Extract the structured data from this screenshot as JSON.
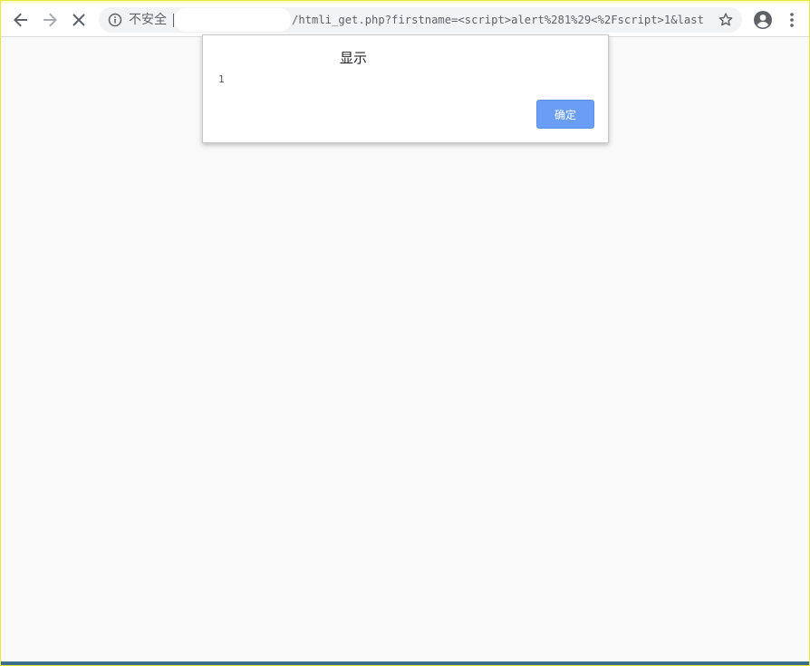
{
  "browser": {
    "security_label": "不安全",
    "url": "/htmli_get.php?firstname=<script>alert%281%29<%2Fscript>1&lastn…",
    "icons": {
      "back": "back-arrow-icon",
      "forward": "forward-arrow-icon",
      "stop": "close-icon",
      "info": "info-icon",
      "star": "star-icon",
      "profile": "account-icon",
      "menu": "more-vert-icon"
    }
  },
  "dialog": {
    "title": "显示",
    "message": "1",
    "ok_label": "确定"
  },
  "colors": {
    "accent_button": "#6a9ef5",
    "page_background": "#f9f9f9"
  }
}
